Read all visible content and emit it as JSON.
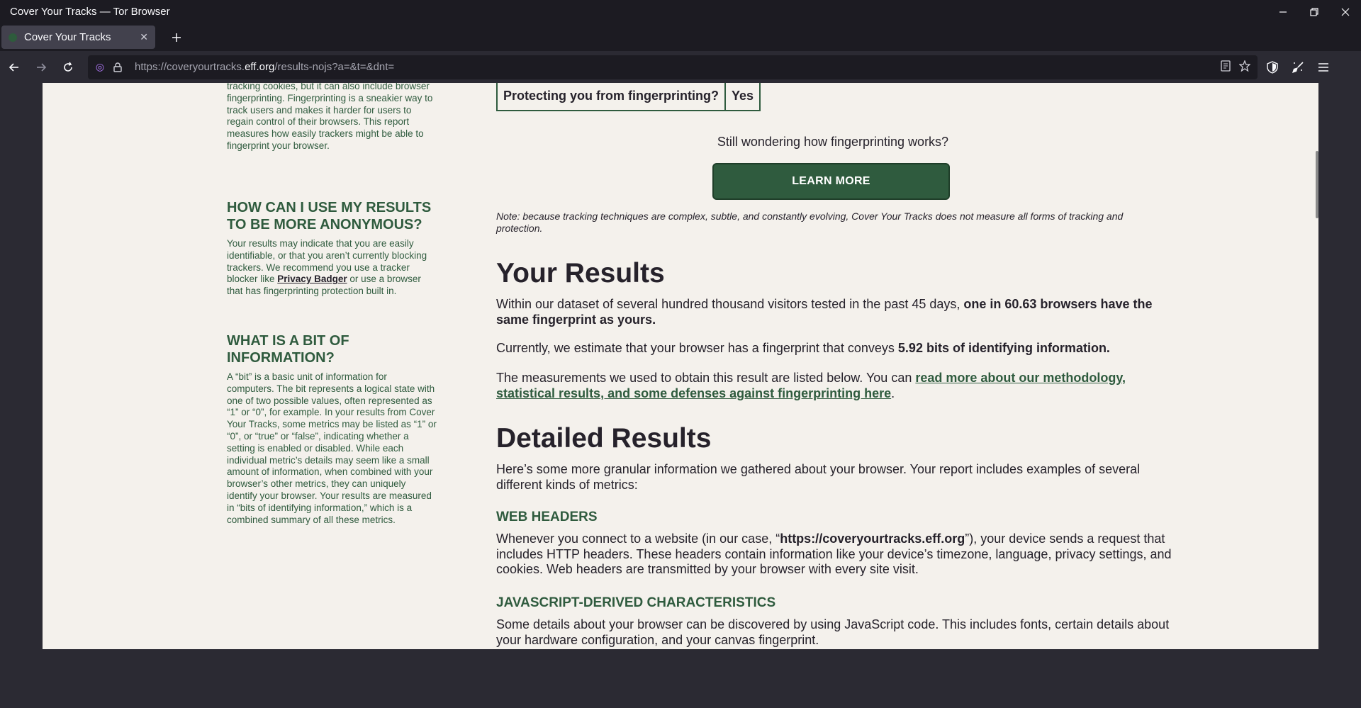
{
  "window": {
    "title": "Cover Your Tracks — Tor Browser"
  },
  "tab": {
    "title": "Cover Your Tracks"
  },
  "urlbar": {
    "prefix": "https://coveryourtracks.",
    "domain": "eff.org",
    "path": "/results-nojs?a=&t=&dnt="
  },
  "sidebar": {
    "intro_text": "tracking cookies, but it can also include browser fingerprinting. Fingerprinting is a sneakier way to track users and makes it harder for users to regain control of their browsers. This report measures how easily trackers might be able to fingerprint your browser.",
    "section2_heading": "How can I use my results to be more anonymous?",
    "section2_text_a": "Your results may indicate that you are easily identifiable, or that you aren’t currently blocking trackers. We recommend you use a tracker blocker like ",
    "section2_link": "Privacy Badger",
    "section2_text_b": " or use a browser that has fingerprinting protection built in.",
    "section3_heading": "What is a bit of information?",
    "section3_text": "A “bit” is a basic unit of information for computers. The bit represents a logical state with one of two possible values, often represented as “1” or “0”, for example. In your results from Cover Your Tracks, some metrics may be listed as “1” or “0”, or “true” or “false”, indicating whether a setting is enabled or disabled. While each individual metric’s details may seem like a small amount of information, when combined with your browser’s other metrics, they can uniquely identify your browser. Your results are measured in “bits of identifying information,” which is a combined summary of all these metrics."
  },
  "main": {
    "fingerprint_question": "Protecting you from fingerprinting?",
    "fingerprint_answer": "Yes",
    "still_wondering": "Still wondering how fingerprinting works?",
    "learn_more": "LEARN MORE",
    "note": "Note: because tracking techniques are complex, subtle, and constantly evolving, Cover Your Tracks does not measure all forms of tracking and protection.",
    "results_heading": "Your Results",
    "results_p1_a": "Within our dataset of several hundred thousand visitors tested in the past 45 days, ",
    "results_p1_b": "one in 60.63 browsers have the same fingerprint as yours.",
    "results_p2_a": "Currently, we estimate that your browser has a fingerprint that conveys ",
    "results_p2_b": "5.92 bits of identifying information.",
    "results_p3_a": "The measurements we used to obtain this result are listed below. You can ",
    "results_p3_link": "read more about our methodology, statistical results, and some defenses against fingerprinting here",
    "results_p3_b": ".",
    "detailed_heading": "Detailed Results",
    "detailed_intro": "Here’s some more granular information we gathered about your browser. Your report includes examples of several different kinds of metrics:",
    "web_headers_heading": "Web Headers",
    "web_headers_a": "Whenever you connect to a website (in our case, “",
    "web_headers_url": "https://coveryourtracks.eff.org",
    "web_headers_b": "”), your device sends a request that includes HTTP headers. These headers contain information like your device’s timezone, language, privacy settings, and cookies. Web headers are transmitted by your browser with every site visit.",
    "js_heading": "JavaScript-Derived Characteristics",
    "js_text": "Some details about your browser can be discovered by using JavaScript code. This includes fonts, certain details about your hardware configuration, and your canvas fingerprint."
  }
}
